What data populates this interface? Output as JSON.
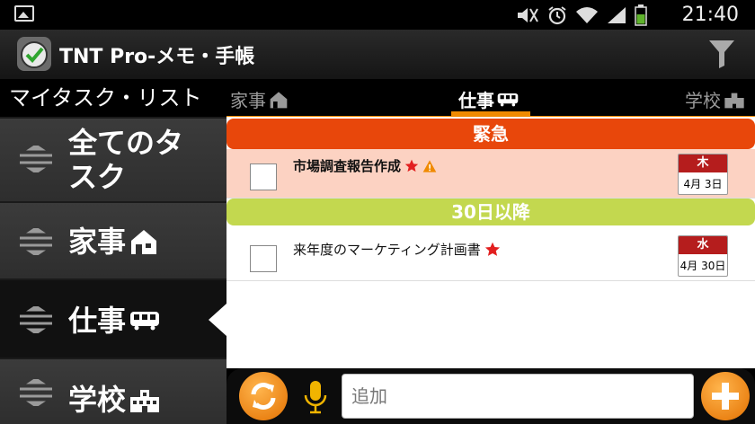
{
  "status_bar": {
    "time": "21:40",
    "icons": [
      "gallery-icon",
      "mute-icon",
      "alarm-icon",
      "wifi-icon",
      "signal-icon",
      "battery-icon"
    ]
  },
  "app_bar": {
    "title": "TNT Pro-メモ・手帳",
    "icons": [
      "app-clock-icon",
      "filter-icon"
    ]
  },
  "sidebar": {
    "title": "マイタスク・リスト",
    "items": [
      {
        "label_line1": "全てのタ",
        "label_line2": "スク",
        "icon": "none"
      },
      {
        "label": "家事",
        "icon": "house-icon"
      },
      {
        "label": "仕事",
        "icon": "bus-icon",
        "active": true
      },
      {
        "label": "学校",
        "icon": "school-building-icon"
      }
    ]
  },
  "tabs": {
    "left": "家事",
    "current": "仕事",
    "right": "学校"
  },
  "sections": {
    "urgent": "緊急",
    "later": "30日以降"
  },
  "tasks": [
    {
      "name": "市場調査報告作成",
      "weekday": "木",
      "date": "4月 3日",
      "flags": [
        "star-icon",
        "warning-icon"
      ]
    },
    {
      "name": "来年度のマーケティング計画書",
      "weekday": "水",
      "date": "4月 30日",
      "flags": [
        "star-icon"
      ]
    }
  ],
  "bottom_bar": {
    "input_placeholder": "追加"
  },
  "colors": {
    "accent_orange": "#f08a00",
    "urgent_header": "#e8470b",
    "later_header": "#c3d84f",
    "urgent_task_bg": "#fcd2c2",
    "calendar_red": "#b51d1d"
  }
}
